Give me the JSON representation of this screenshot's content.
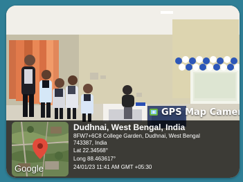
{
  "gps_stamp": {
    "brand_label": "GPS Map Camera",
    "location_title": "Dudhnai, West Bengal, India",
    "address_line1": "8FW7+6C8 College Garden, Dudhnai, West Bengal",
    "address_line2": "743387, India",
    "latitude": "Lat 22.34568°",
    "longitude": "Long 88.463617°",
    "timestamp": "24/01/23 11:41 AM GMT +05:30",
    "map_provider": "Google"
  },
  "colors": {
    "frame": "#2f7f96",
    "overlay": "#000000",
    "marker": "#e14b3a"
  },
  "icons": [
    "gps-camera-icon",
    "map-marker-icon"
  ]
}
